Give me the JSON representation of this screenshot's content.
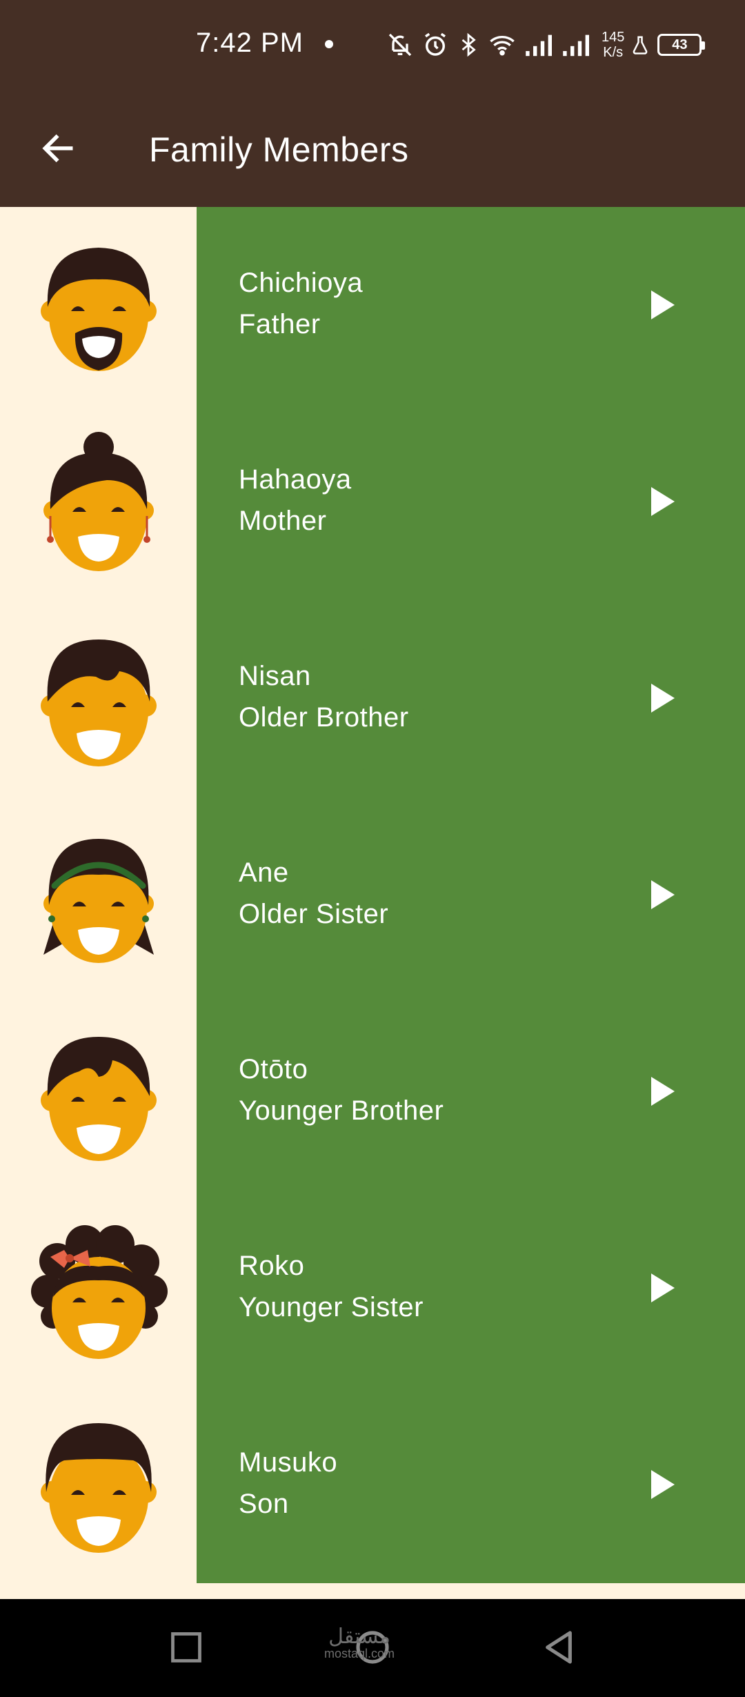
{
  "status_bar": {
    "time": "7:42 PM",
    "net_speed_value": "145",
    "net_speed_unit": "K/s",
    "battery": "43",
    "icons": [
      "mute-icon",
      "alarm-icon",
      "bluetooth-icon",
      "wifi-icon",
      "signal-icon",
      "signal-icon",
      "lab-icon",
      "battery-icon"
    ]
  },
  "app_bar": {
    "title": "Family Members",
    "back_icon": "arrow-left-icon"
  },
  "members": [
    {
      "japanese": "Chichioya",
      "english": "Father"
    },
    {
      "japanese": "Hahaoya",
      "english": "Mother"
    },
    {
      "japanese": "Nisan",
      "english": "Older Brother"
    },
    {
      "japanese": "Ane",
      "english": "Older Sister"
    },
    {
      "japanese": "Otōto",
      "english": "Younger Brother"
    },
    {
      "japanese": "Roko",
      "english": "Younger Sister"
    },
    {
      "japanese": "Musuko",
      "english": "Son"
    }
  ],
  "watermark": {
    "text": "مستقل",
    "domain": "mostaql.com"
  },
  "colors": {
    "app_bar": "#452f25",
    "row_text_bg": "#558b3a",
    "avatar_bg": "#fff3df",
    "skin": "#f0a30a",
    "hair": "#2e1a15"
  }
}
